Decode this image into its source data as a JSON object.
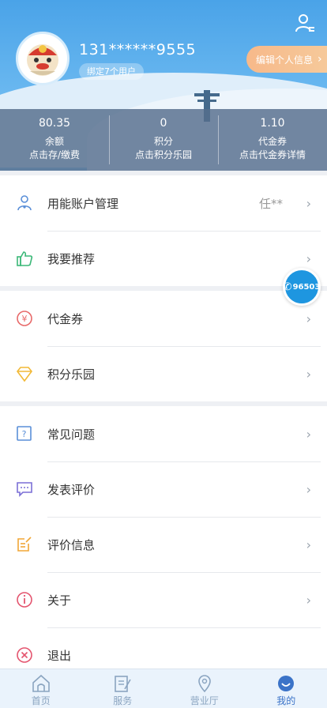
{
  "header": {
    "phone": "131******9555",
    "bind_label": "绑定7个用户",
    "edit_label": "编辑个人信息"
  },
  "stats": [
    {
      "value": "80.35",
      "label": "余额",
      "sub": "点击存/缴费"
    },
    {
      "value": "0",
      "label": "积分",
      "sub": "点击积分乐园"
    },
    {
      "value": "1.10",
      "label": "代金券",
      "sub": "点击代金券详情"
    }
  ],
  "group1": [
    {
      "label": "用能账户管理",
      "extra": "任**"
    },
    {
      "label": "我要推荐"
    }
  ],
  "group2": [
    {
      "label": "代金券"
    },
    {
      "label": "积分乐园"
    }
  ],
  "group3": [
    {
      "label": "常见问题"
    },
    {
      "label": "发表评价"
    },
    {
      "label": "评价信息"
    },
    {
      "label": "关于"
    },
    {
      "label": "退出"
    }
  ],
  "hotline": "96503",
  "tabbar": [
    {
      "label": "首页"
    },
    {
      "label": "服务"
    },
    {
      "label": "营业厅"
    },
    {
      "label": "我的"
    }
  ],
  "colors": {
    "header_blue": "#4aa3e8",
    "accent_orange": "#f7b98a",
    "tab_active": "#3b73c8"
  }
}
